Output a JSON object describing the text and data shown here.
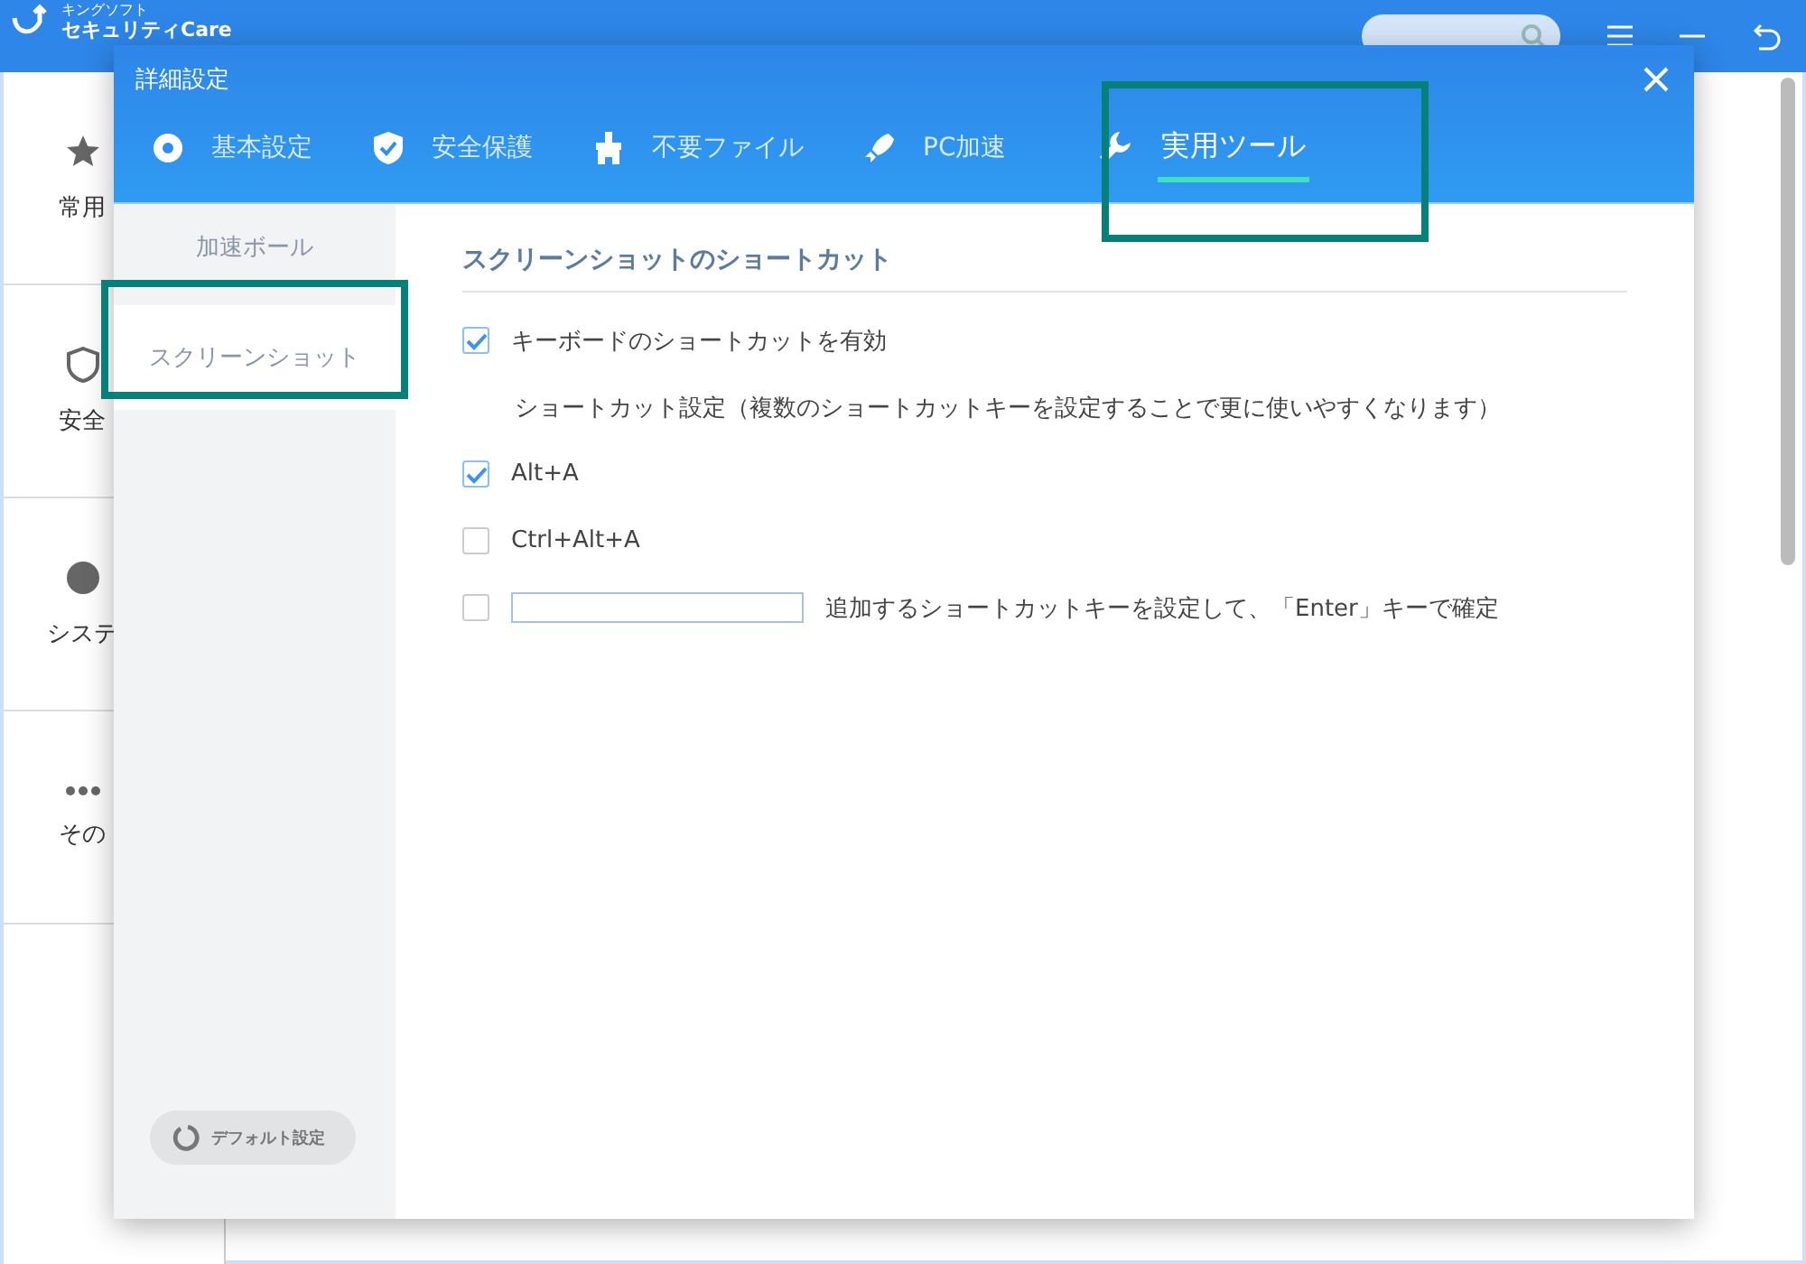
{
  "app": {
    "logo_small": "キングソフト",
    "logo_main": "セキュリティCare",
    "nav": [
      {
        "label": "常用"
      },
      {
        "label": "安全"
      },
      {
        "label": "システ"
      },
      {
        "label": "その"
      }
    ]
  },
  "dialog": {
    "title": "詳細設定",
    "tabs": [
      {
        "label": "基本設定",
        "selected": false
      },
      {
        "label": "安全保護",
        "selected": false
      },
      {
        "label": "不要ファイル",
        "selected": false
      },
      {
        "label": "PC加速",
        "selected": false
      },
      {
        "label": "実用ツール",
        "selected": true
      }
    ],
    "sidebar": [
      {
        "label": "加速ボール",
        "selected": false
      },
      {
        "label": "スクリーンショット",
        "selected": true
      }
    ],
    "default_button": "デフォルト設定",
    "section_title": "スクリーンショットのショートカット",
    "options": [
      {
        "kind": "checkbox",
        "label": "キーボードのショートカットを有効",
        "checked": true
      },
      {
        "kind": "note",
        "label": "ショートカット設定（複数のショートカットキーを設定することで更に使いやすくなります）"
      },
      {
        "kind": "checkbox",
        "label": "Alt+A",
        "checked": true
      },
      {
        "kind": "checkbox",
        "label": "Ctrl+Alt+A",
        "checked": false
      },
      {
        "kind": "input",
        "label": "追加するショートカットキーを設定して、「Enter」キーで確定",
        "checked": false
      }
    ]
  }
}
